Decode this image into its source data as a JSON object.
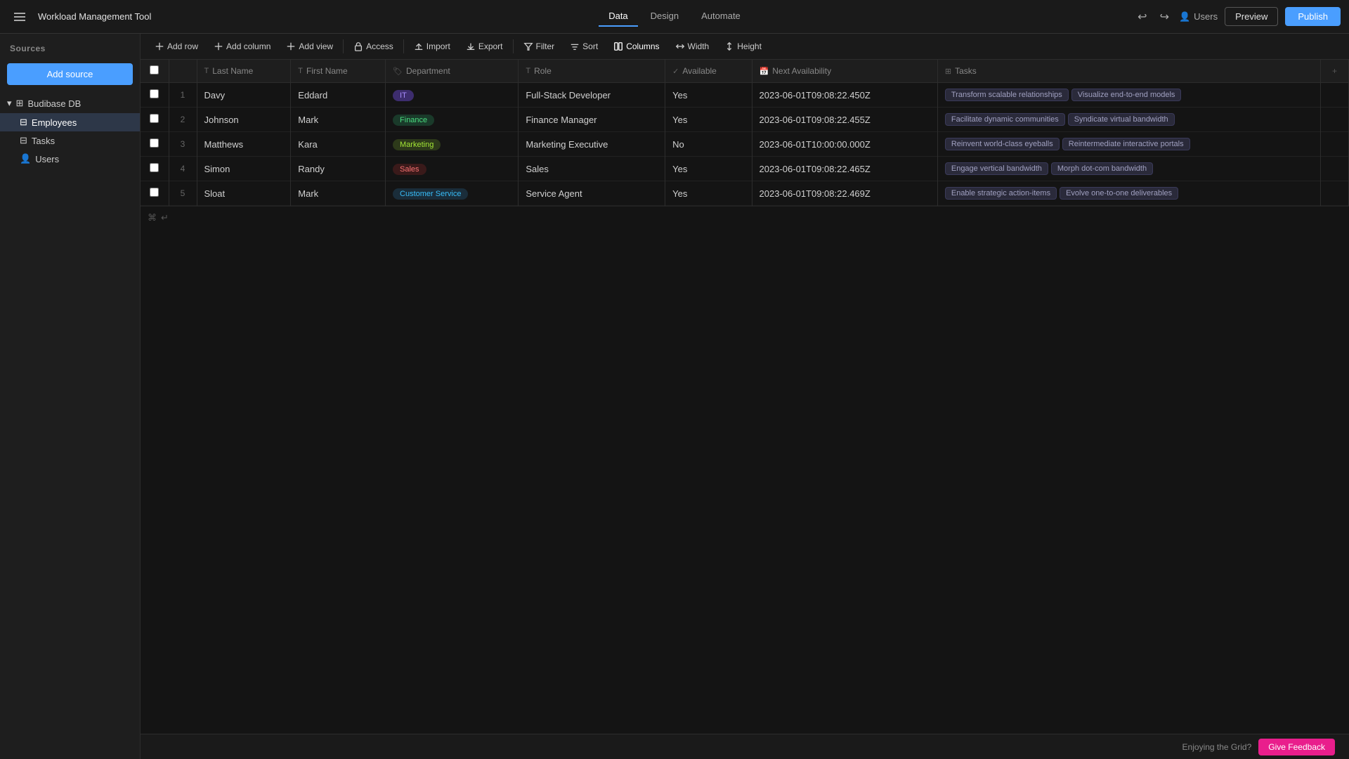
{
  "app": {
    "title": "Workload Management Tool"
  },
  "topbar": {
    "nav_tabs": [
      {
        "id": "data",
        "label": "Data",
        "active": true
      },
      {
        "id": "design",
        "label": "Design",
        "active": false
      },
      {
        "id": "automate",
        "label": "Automate",
        "active": false
      }
    ],
    "users_label": "Users",
    "preview_label": "Preview",
    "publish_label": "Publish"
  },
  "sidebar": {
    "header": "Sources",
    "add_source_label": "Add source",
    "db": {
      "name": "Budibase DB",
      "items": [
        {
          "id": "employees",
          "label": "Employees",
          "active": true
        },
        {
          "id": "tasks",
          "label": "Tasks",
          "active": false
        },
        {
          "id": "users",
          "label": "Users",
          "active": false
        }
      ]
    }
  },
  "toolbar": {
    "buttons": [
      {
        "id": "add-row",
        "label": "Add row",
        "icon": "plus"
      },
      {
        "id": "add-column",
        "label": "Add column",
        "icon": "plus"
      },
      {
        "id": "add-view",
        "label": "Add view",
        "icon": "plus"
      },
      {
        "id": "access",
        "label": "Access",
        "icon": "lock"
      },
      {
        "id": "import",
        "label": "Import",
        "icon": "upload"
      },
      {
        "id": "export",
        "label": "Export",
        "icon": "download"
      },
      {
        "id": "filter",
        "label": "Filter",
        "icon": "filter"
      },
      {
        "id": "sort",
        "label": "Sort",
        "icon": "sort"
      },
      {
        "id": "columns",
        "label": "Columns",
        "icon": "columns"
      },
      {
        "id": "width",
        "label": "Width",
        "icon": "width"
      },
      {
        "id": "height",
        "label": "Height",
        "icon": "height"
      }
    ]
  },
  "table": {
    "columns": [
      {
        "id": "last-name",
        "label": "Last Name",
        "type": "text"
      },
      {
        "id": "first-name",
        "label": "First Name",
        "type": "text"
      },
      {
        "id": "department",
        "label": "Department",
        "type": "tag"
      },
      {
        "id": "role",
        "label": "Role",
        "type": "text"
      },
      {
        "id": "available",
        "label": "Available",
        "type": "bool"
      },
      {
        "id": "next-availability",
        "label": "Next Availability",
        "type": "datetime"
      },
      {
        "id": "tasks",
        "label": "Tasks",
        "type": "tags"
      }
    ],
    "rows": [
      {
        "num": 1,
        "last_name": "Davy",
        "first_name": "Eddard",
        "department": "IT",
        "department_class": "tag-it",
        "role": "Full-Stack Developer",
        "available": "Yes",
        "next_availability": "2023-06-01T09:08:22.450Z",
        "tasks": [
          "Transform scalable relationships",
          "Visualize end-to-end models"
        ]
      },
      {
        "num": 2,
        "last_name": "Johnson",
        "first_name": "Mark",
        "department": "Finance",
        "department_class": "tag-finance",
        "role": "Finance Manager",
        "available": "Yes",
        "next_availability": "2023-06-01T09:08:22.455Z",
        "tasks": [
          "Facilitate dynamic communities",
          "Syndicate virtual bandwidth"
        ]
      },
      {
        "num": 3,
        "last_name": "Matthews",
        "first_name": "Kara",
        "department": "Marketing",
        "department_class": "tag-marketing",
        "role": "Marketing Executive",
        "available": "No",
        "next_availability": "2023-06-01T10:00:00.000Z",
        "tasks": [
          "Reinvent world-class eyeballs",
          "Reintermediate interactive portals"
        ]
      },
      {
        "num": 4,
        "last_name": "Simon",
        "first_name": "Randy",
        "department": "Sales",
        "department_class": "tag-sales",
        "role": "Sales",
        "available": "Yes",
        "next_availability": "2023-06-01T09:08:22.465Z",
        "tasks": [
          "Engage vertical bandwidth",
          "Morph dot-com bandwidth"
        ]
      },
      {
        "num": 5,
        "last_name": "Sloat",
        "first_name": "Mark",
        "department": "Customer Service",
        "department_class": "tag-cs",
        "role": "Service Agent",
        "available": "Yes",
        "next_availability": "2023-06-01T09:08:22.469Z",
        "tasks": [
          "Enable strategic action-items",
          "Evolve one-to-one deliverables"
        ]
      }
    ]
  },
  "bottom": {
    "enjoying_text": "Enjoying the Grid?",
    "feedback_label": "Give Feedback"
  }
}
